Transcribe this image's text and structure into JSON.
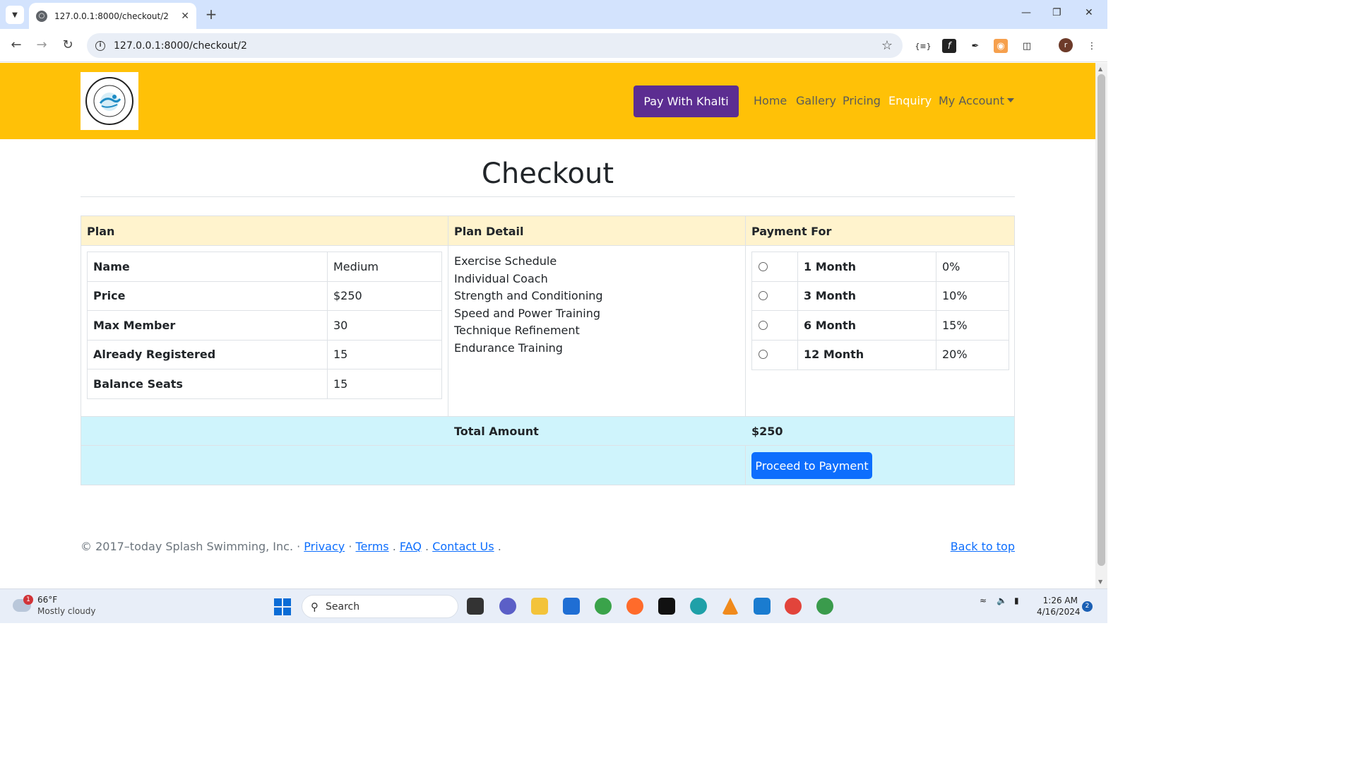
{
  "browser": {
    "tab_title": "127.0.0.1:8000/checkout/2",
    "url": "127.0.0.1:8000/checkout/2",
    "profile_initial": "r"
  },
  "navbar": {
    "brand_color": "#ffc107",
    "khalti_button": "Pay With Khalti",
    "khalti_color": "#5c2d91",
    "links": [
      "Home",
      "Gallery",
      "Pricing",
      "Enquiry",
      "My Account"
    ],
    "active_link": "Enquiry"
  },
  "page": {
    "title": "Checkout"
  },
  "table": {
    "headers": {
      "plan": "Plan",
      "plan_detail": "Plan Detail",
      "payment_for": "Payment For"
    },
    "plan_rows": [
      {
        "label": "Name",
        "value": "Medium"
      },
      {
        "label": "Price",
        "value": "$250"
      },
      {
        "label": "Max Member",
        "value": "30"
      },
      {
        "label": "Already Registered",
        "value": "15"
      },
      {
        "label": "Balance Seats",
        "value": "15"
      }
    ],
    "plan_details": [
      "Exercise Schedule",
      "Individual Coach",
      "Strength and Conditioning",
      "Speed and Power Training",
      "Technique Refinement",
      "Endurance Training"
    ],
    "payment_options": [
      {
        "duration": "1 Month",
        "discount": "0%"
      },
      {
        "duration": "3 Month",
        "discount": "10%"
      },
      {
        "duration": "6 Month",
        "discount": "15%"
      },
      {
        "duration": "12 Month",
        "discount": "20%"
      }
    ],
    "total_label": "Total Amount",
    "total_value": "$250",
    "proceed_button": "Proceed to Payment"
  },
  "footer": {
    "copyright": "© 2017–today Splash Swimming, Inc. ·",
    "privacy": "Privacy",
    "sep1": "·",
    "terms": "Terms",
    "sep2": ".",
    "faq": "FAQ",
    "sep3": ".",
    "contact": "Contact Us",
    "sep4": ".",
    "back_to_top": "Back to top"
  },
  "taskbar": {
    "weather_temp": "66°F",
    "weather_condition": "Mostly cloudy",
    "weather_badge": "1",
    "search_placeholder": "Search",
    "time": "1:26 AM",
    "date": "4/16/2024",
    "notification_count": "2"
  }
}
